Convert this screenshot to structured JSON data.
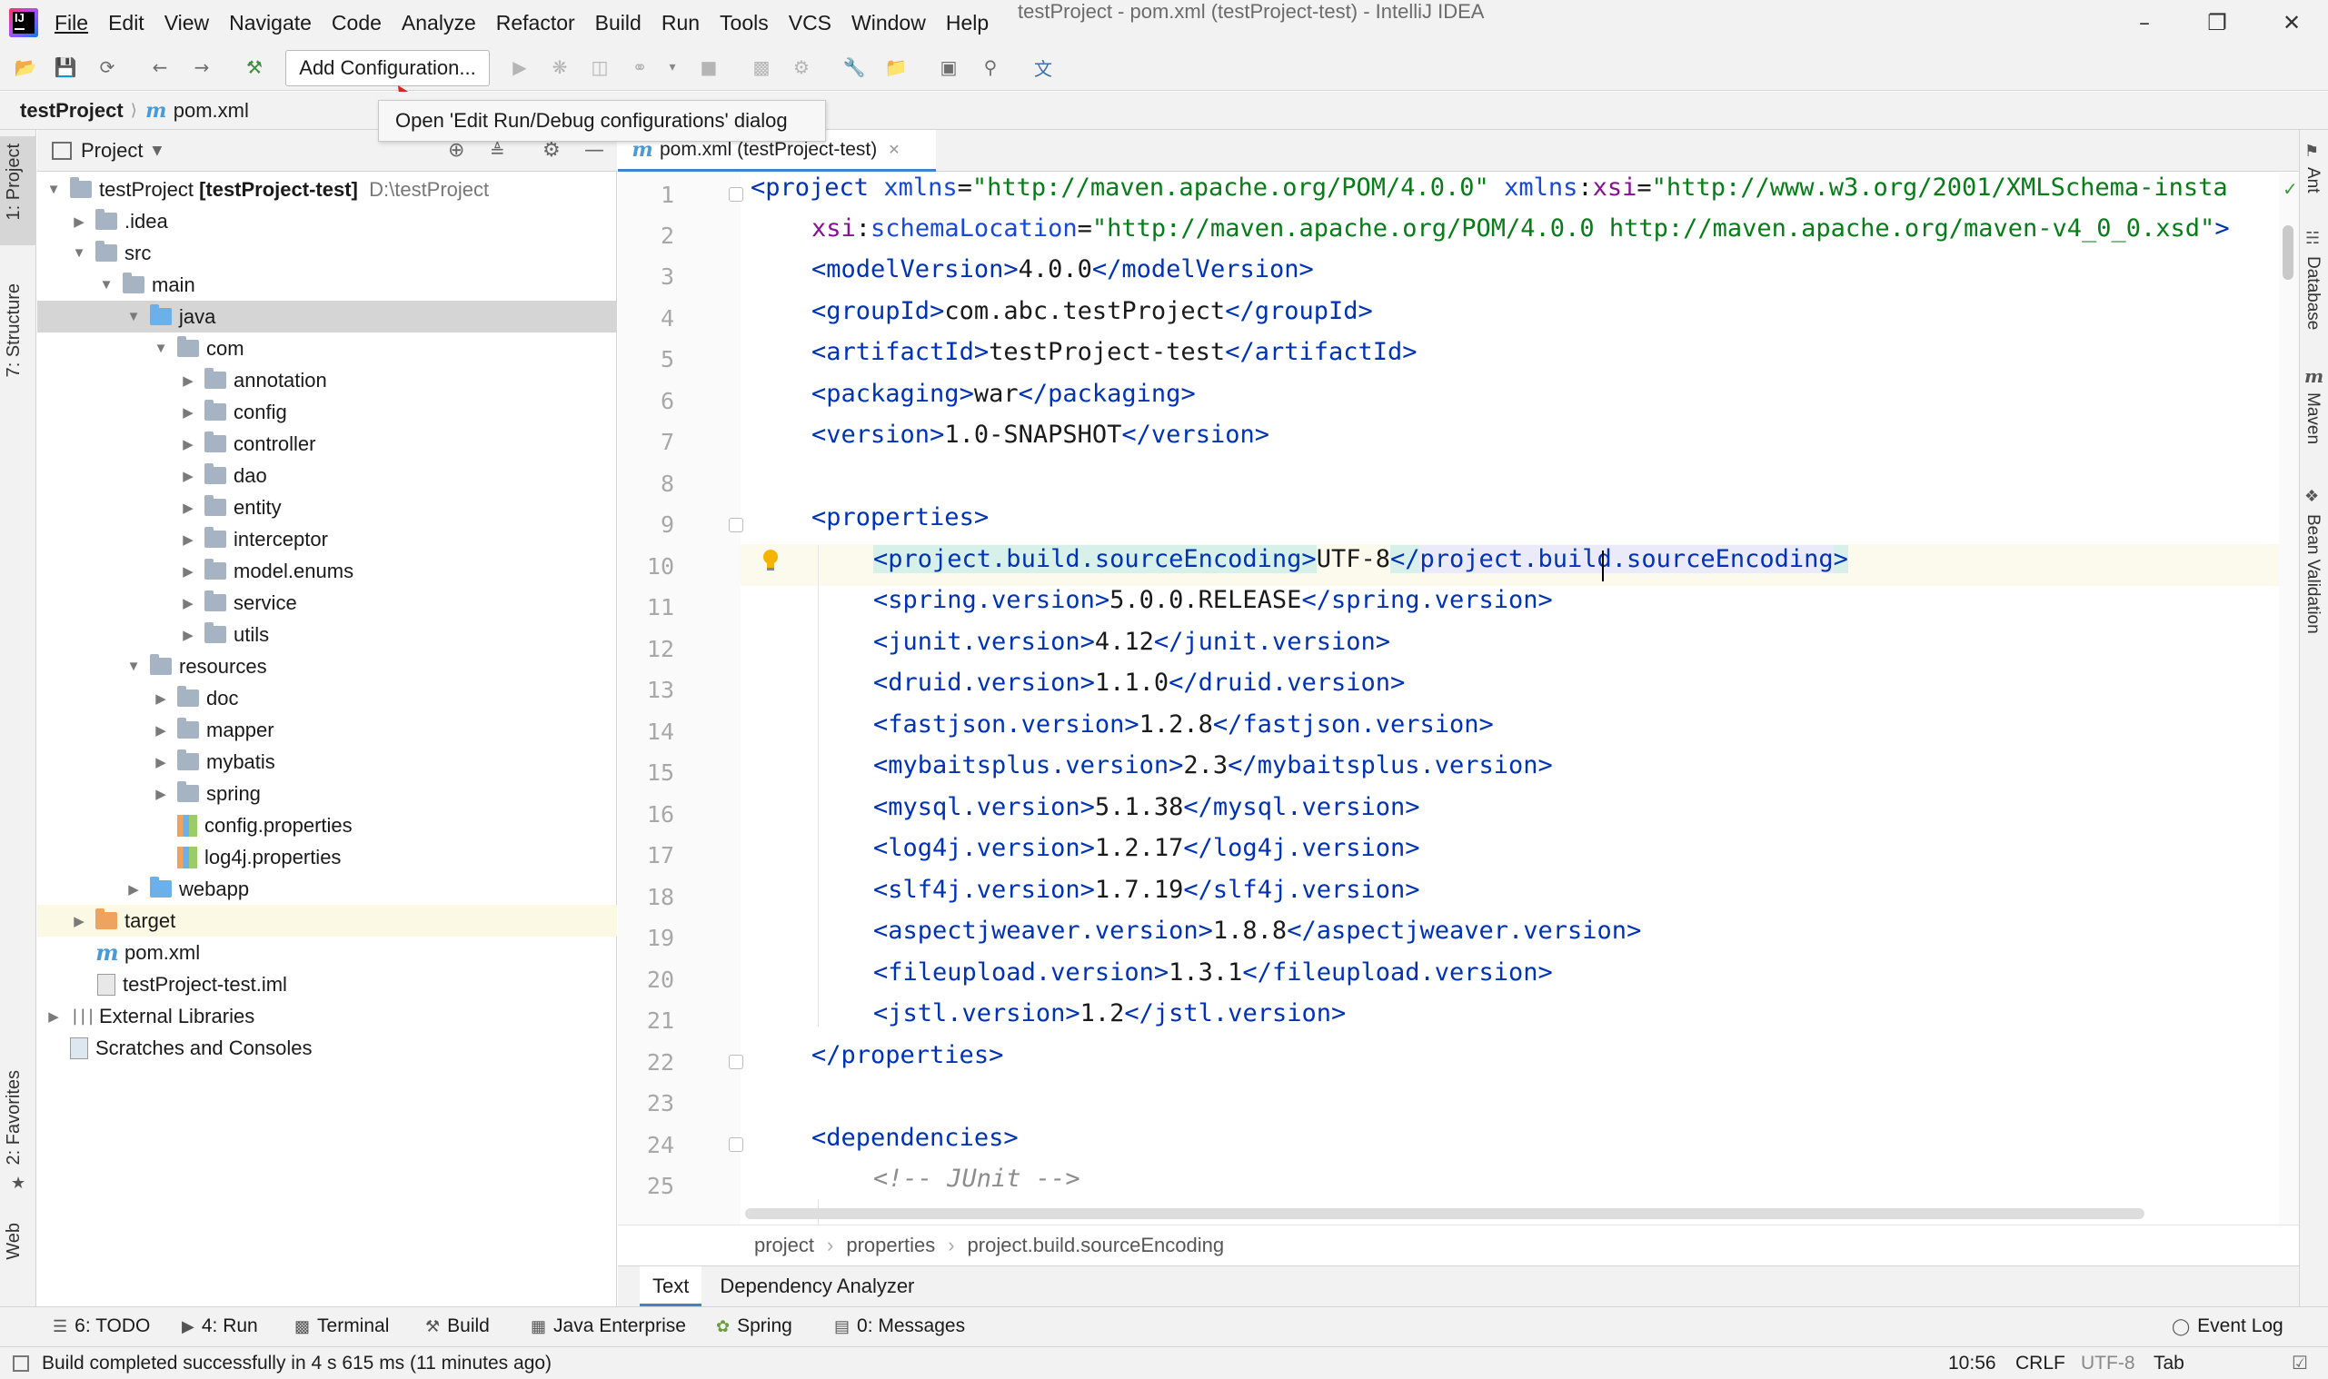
{
  "menubar": {
    "items": [
      "File",
      "Edit",
      "View",
      "Navigate",
      "Code",
      "Analyze",
      "Refactor",
      "Build",
      "Run",
      "Tools",
      "VCS",
      "Window",
      "Help"
    ],
    "window_title": "testProject - pom.xml (testProject-test) - IntelliJ IDEA"
  },
  "toolbar": {
    "add_configuration_label": "Add Configuration...",
    "tooltip": "Open 'Edit Run/Debug configurations' dialog"
  },
  "breadcrumbs": {
    "project": "testProject",
    "file": "pom.xml"
  },
  "left_stripe": {
    "project_tab": "1: Project",
    "structure_tab": "7: Structure",
    "favorites_tab": "2: Favorites",
    "web_tab": "Web"
  },
  "project_panel": {
    "title": "Project",
    "tree": [
      {
        "label": "testProject",
        "suffix": "[testProject-test]",
        "path": "D:\\testProject"
      },
      {
        "label": ".idea"
      },
      {
        "label": "src"
      },
      {
        "label": "main"
      },
      {
        "label": "java"
      },
      {
        "label": "com"
      },
      {
        "label": "annotation"
      },
      {
        "label": "config"
      },
      {
        "label": "controller"
      },
      {
        "label": "dao"
      },
      {
        "label": "entity"
      },
      {
        "label": "interceptor"
      },
      {
        "label": "model.enums"
      },
      {
        "label": "service"
      },
      {
        "label": "utils"
      },
      {
        "label": "resources"
      },
      {
        "label": "doc"
      },
      {
        "label": "mapper"
      },
      {
        "label": "mybatis"
      },
      {
        "label": "spring"
      },
      {
        "label": "config.properties"
      },
      {
        "label": "log4j.properties"
      },
      {
        "label": "webapp"
      },
      {
        "label": "target"
      },
      {
        "label": "pom.xml"
      },
      {
        "label": "testProject-test.iml"
      },
      {
        "label": "External Libraries"
      },
      {
        "label": "Scratches and Consoles"
      }
    ]
  },
  "editor": {
    "tab_label": "pom.xml (testProject-test)",
    "line_numbers": [
      "1",
      "2",
      "3",
      "4",
      "5",
      "6",
      "7",
      "8",
      "9",
      "10",
      "11",
      "12",
      "13",
      "14",
      "15",
      "16",
      "17",
      "18",
      "19",
      "20",
      "21",
      "22",
      "23",
      "24",
      "25"
    ],
    "line1": {
      "open": "<project ",
      "a1": "xmlns",
      "eq1": "=",
      "v1": "\"http://maven.apache.org/POM/4.0.0\"",
      "a2": " xmlns",
      "c2": ":",
      "a2b": "xsi",
      "eq2": "=",
      "v2": "\"http://www.w3.org/2001/XMLSchema-insta"
    },
    "line2": {
      "a": "xsi",
      "c": ":",
      "b": "schemaLocation",
      "eq": "=",
      "v": "\"http://maven.apache.org/POM/4.0.0 http://maven.apache.org/maven-v4_0_0.xsd\"",
      "close": ">"
    },
    "elements": [
      {
        "tag": "modelVersion",
        "value": "4.0.0"
      },
      {
        "tag": "groupId",
        "value": "com.abc.testProject"
      },
      {
        "tag": "artifactId",
        "value": "testProject-test"
      },
      {
        "tag": "packaging",
        "value": "war"
      },
      {
        "tag": "version",
        "value": "1.0-SNAPSHOT"
      }
    ],
    "properties_tag": "properties",
    "properties": [
      {
        "tag": "project.build.sourceEncoding",
        "value": "UTF-8"
      },
      {
        "tag": "spring.version",
        "value": "5.0.0.RELEASE"
      },
      {
        "tag": "junit.version",
        "value": "4.12"
      },
      {
        "tag": "druid.version",
        "value": "1.1.0"
      },
      {
        "tag": "fastjson.version",
        "value": "1.2.8"
      },
      {
        "tag": "mybaitsplus.version",
        "value": "2.3"
      },
      {
        "tag": "mysql.version",
        "value": "5.1.38"
      },
      {
        "tag": "log4j.version",
        "value": "1.2.17"
      },
      {
        "tag": "slf4j.version",
        "value": "1.7.19"
      },
      {
        "tag": "aspectjweaver.version",
        "value": "1.8.8"
      },
      {
        "tag": "fileupload.version",
        "value": "1.3.1"
      },
      {
        "tag": "jstl.version",
        "value": "1.2"
      }
    ],
    "dependencies_tag": "dependencies",
    "comment": "<!-- JUnit -->",
    "breadcrumb": [
      "project",
      "properties",
      "project.build.sourceEncoding"
    ],
    "bottom_tabs": [
      "Text",
      "Dependency Analyzer"
    ]
  },
  "right_stripe": [
    "Ant",
    "Database",
    "Maven",
    "Bean Validation"
  ],
  "tool_windows": {
    "todo": "6: TODO",
    "run": "4: Run",
    "terminal": "Terminal",
    "build": "Build",
    "java_enterprise": "Java Enterprise",
    "spring": "Spring",
    "messages": "0: Messages",
    "event_log": "Event Log"
  },
  "status_bar": {
    "message": "Build completed successfully in 4 s 615 ms (11 minutes ago)",
    "position": "10:56",
    "line_sep": "CRLF",
    "encoding": "UTF-8",
    "indent": "Tab"
  }
}
